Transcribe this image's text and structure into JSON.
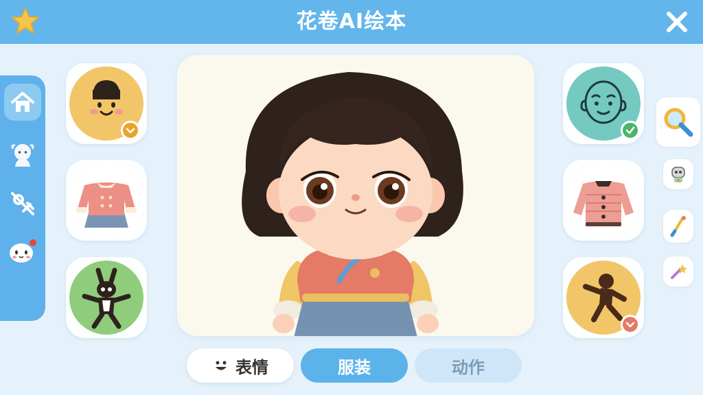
{
  "app": {
    "title": "花卷AI绘本"
  },
  "topbar": {
    "left_icon": "star-icon",
    "right_icon": "close-icon"
  },
  "leftnav": {
    "items": [
      "home-icon",
      "avatar-icon",
      "settings-tool-icon",
      "pet-icon"
    ],
    "active_index": 0,
    "notification_dot_on": "pet-icon"
  },
  "left_options": [
    {
      "name": "face-option",
      "depicts": "girl-face",
      "bg": "#f2c568",
      "selected": true,
      "badge_color": "#e9a52a"
    },
    {
      "name": "outfit-option",
      "depicts": "pink-jacket-blue-skirt",
      "bg": "#ffffff",
      "selected": false
    },
    {
      "name": "pose-option",
      "depicts": "rabbit-dance-pose",
      "bg": "#8fcd7c",
      "selected": false
    }
  ],
  "right_options": [
    {
      "name": "face-outline-option",
      "depicts": "face-outline",
      "bg": "#74c9c0",
      "selected": true,
      "badge_color": "#4ab56b"
    },
    {
      "name": "jacket-option",
      "depicts": "pink-quilted-jacket",
      "bg": "#ffffff",
      "selected": false
    },
    {
      "name": "dance-pose-option",
      "depicts": "dancing-figure",
      "bg": "#f2c568",
      "selected": true,
      "badge_color": "#e37a66"
    }
  ],
  "tools": [
    "magnifier-icon",
    "robot-sticker-icon",
    "paintbrush-icon",
    "magic-wand-icon"
  ],
  "tabs": {
    "expression": "表情",
    "clothing": "服装",
    "action": "动作",
    "active": "clothing"
  },
  "colors": {
    "primary": "#63b6ec",
    "background": "#e6f2fb",
    "active_tab": "#5cb3ea",
    "inactive_tab": "#cfe6f8"
  }
}
